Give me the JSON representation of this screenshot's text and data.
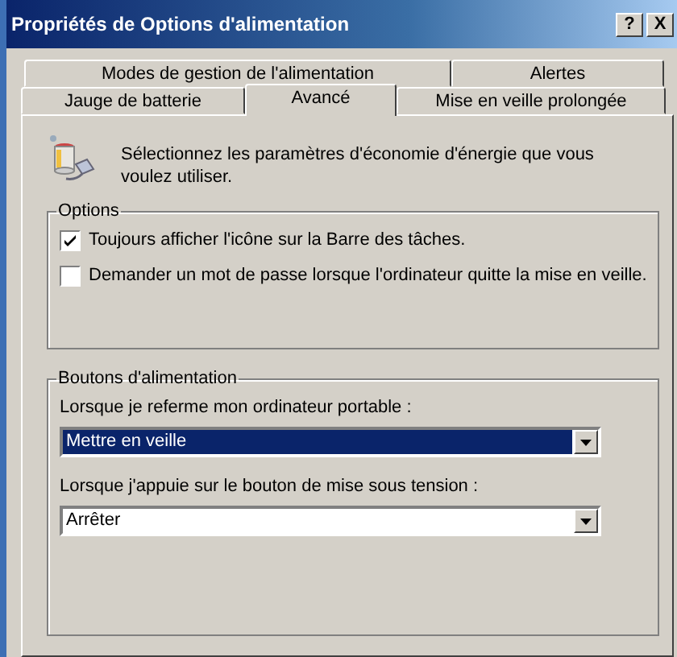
{
  "window": {
    "title": "Propriétés de Options d'alimentation",
    "buttons": [
      "?",
      "X"
    ]
  },
  "tab_rows": [
    [
      {
        "label": "Modes de gestion de l'alimentation",
        "selected": false
      },
      {
        "label": "Alertes",
        "selected": false
      }
    ],
    [
      {
        "label": "Jauge de batterie",
        "selected": false
      },
      {
        "label": "Avancé",
        "selected": true
      },
      {
        "label": "Mise en veille prolongée",
        "selected": false
      }
    ]
  ],
  "description": "Sélectionnez les paramètres d'économie d'énergie que vous voulez utiliser.",
  "options": {
    "title": "Options",
    "items": [
      {
        "label": "Toujours afficher l'icône sur la Barre des tâches.",
        "checked": true
      },
      {
        "label": "Demander un mot de passe lorsque l'ordinateur quitte la mise en veille.",
        "checked": false
      }
    ]
  },
  "power_buttons": {
    "title": "Boutons d'alimentation",
    "fields": [
      {
        "label": "Lorsque je referme mon ordinateur portable :",
        "value": "Mettre en veille",
        "selected": true
      },
      {
        "label": "Lorsque j'appuie sur le bouton de mise sous tension :",
        "value": "Arrêter",
        "selected": false
      }
    ]
  }
}
